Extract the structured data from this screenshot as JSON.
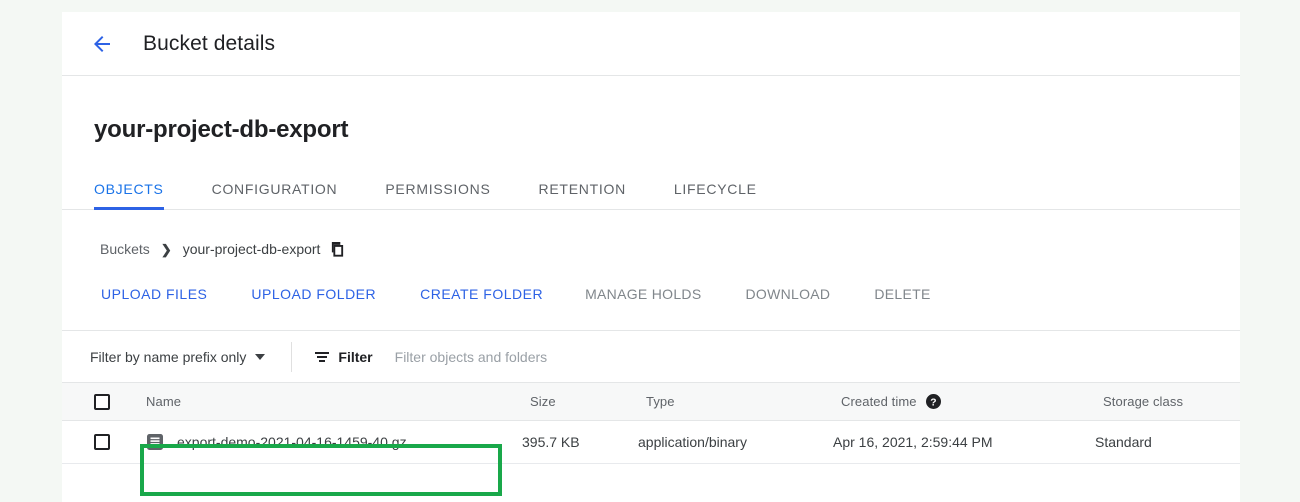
{
  "topbar": {
    "back_icon": "arrow-left-icon",
    "title": "Bucket details"
  },
  "bucket": {
    "name": "your-project-db-export"
  },
  "tabs": [
    {
      "label": "OBJECTS",
      "active": true
    },
    {
      "label": "CONFIGURATION",
      "active": false
    },
    {
      "label": "PERMISSIONS",
      "active": false
    },
    {
      "label": "RETENTION",
      "active": false
    },
    {
      "label": "LIFECYCLE",
      "active": false
    }
  ],
  "breadcrumb": {
    "root": "Buckets",
    "separator": "❯",
    "current": "your-project-db-export",
    "copy_icon": "copy-icon"
  },
  "actions": [
    {
      "label": "UPLOAD FILES",
      "enabled": true
    },
    {
      "label": "UPLOAD FOLDER",
      "enabled": true
    },
    {
      "label": "CREATE FOLDER",
      "enabled": true
    },
    {
      "label": "MANAGE HOLDS",
      "enabled": false
    },
    {
      "label": "DOWNLOAD",
      "enabled": false
    },
    {
      "label": "DELETE",
      "enabled": false
    }
  ],
  "filterbar": {
    "prefix_mode": "Filter by name prefix only",
    "filter_icon": "filter-icon",
    "filter_label": "Filter",
    "filter_placeholder": "Filter objects and folders",
    "filter_value": ""
  },
  "table": {
    "columns": [
      {
        "key": "name",
        "label": "Name"
      },
      {
        "key": "size",
        "label": "Size"
      },
      {
        "key": "type",
        "label": "Type"
      },
      {
        "key": "time",
        "label": "Created time",
        "help_icon": "help-icon"
      },
      {
        "key": "class",
        "label": "Storage class"
      }
    ],
    "rows": [
      {
        "selected": false,
        "file_icon": "file-document-icon",
        "name": "export-demo-2021-04-16-1459-40.gz",
        "size": "395.7 KB",
        "type": "application/binary",
        "time": "Apr 16, 2021, 2:59:44 PM",
        "class": "Standard"
      }
    ]
  },
  "annotation": {
    "highlight_color": "#19a84a",
    "target": "export-demo-2021-04-16-1459-40.gz"
  },
  "colors": {
    "accent_blue": "#2d62e5",
    "link_blue": "#1a73e8",
    "page_background": "#f4f8f4",
    "card_background": "#ffffff",
    "text_primary": "#202124",
    "text_secondary": "#5f6368",
    "highlight_green": "#19a84a"
  }
}
